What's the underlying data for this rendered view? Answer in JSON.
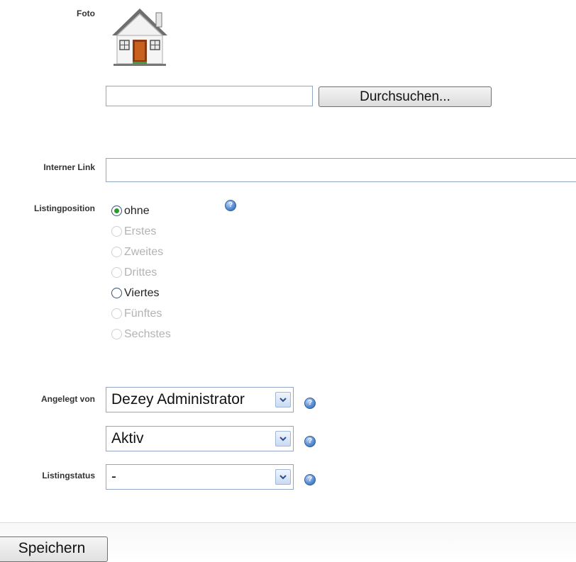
{
  "photo": {
    "label": "Foto",
    "image_icon": "house-icon",
    "file_value": "",
    "browse_label": "Durchsuchen..."
  },
  "internal_link": {
    "label": "Interner Link",
    "value": ""
  },
  "listing_position": {
    "label": "Listingposition",
    "help_icon": "help-icon",
    "options": [
      {
        "label": "ohne",
        "state": "checked"
      },
      {
        "label": "Erstes",
        "state": "disabled"
      },
      {
        "label": "Zweites",
        "state": "disabled"
      },
      {
        "label": "Drittes",
        "state": "disabled"
      },
      {
        "label": "Viertes",
        "state": "enabled"
      },
      {
        "label": "Fünftes",
        "state": "disabled"
      },
      {
        "label": "Sechstes",
        "state": "disabled"
      }
    ]
  },
  "created_by": {
    "label": "Angelegt von",
    "selected": "Dezey Administrator"
  },
  "status": {
    "selected": "Aktiv"
  },
  "listing_status": {
    "label": "Listingstatus",
    "selected": "-"
  },
  "footer": {
    "save_label": "Speichern"
  },
  "colors": {
    "accent_blue": "#5b8fd6",
    "radio_checked": "#2c9b2e",
    "input_border": "#8fa7c4"
  }
}
